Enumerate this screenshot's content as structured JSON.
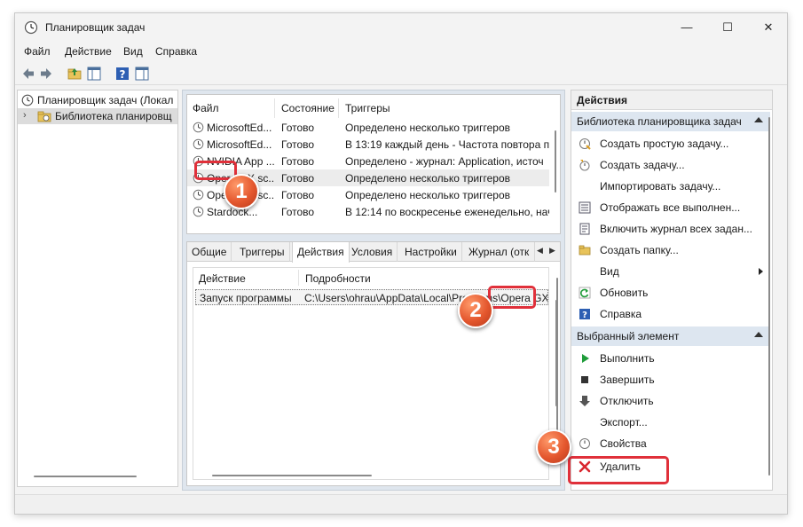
{
  "window": {
    "title": "Планировщик задач",
    "min_glyph": "—",
    "max_glyph": "☐",
    "close_glyph": "✕"
  },
  "menu": {
    "file": "Файл",
    "action": "Действие",
    "view": "Вид",
    "help": "Справка"
  },
  "tree": {
    "root": "Планировщик задач (Локал",
    "library": "Библиотека планировщ"
  },
  "tasks": {
    "columns": [
      "Файл",
      "Состояние",
      "Триггеры"
    ],
    "rows": [
      {
        "name": "MicrosoftEd...",
        "status": "Готово",
        "trigger": "Определено несколько триггеров"
      },
      {
        "name": "MicrosoftEd...",
        "status": "Готово",
        "trigger": "В 13:19 каждый день - Частота повтора по"
      },
      {
        "name": "NVIDIA App ...",
        "status": "Готово",
        "trigger": "Определено - журнал: Application, источ"
      },
      {
        "name": "Opera GX sc...",
        "status": "Готово",
        "trigger": "Определено несколько триггеров"
      },
      {
        "name": "Opera GX sc...",
        "status": "Готово",
        "trigger": "Определено несколько триггеров"
      },
      {
        "name": "Stardock...",
        "status": "Готово",
        "trigger": "В 12:14 по воскресенье еженедельно, нач"
      }
    ]
  },
  "details": {
    "tabs": [
      "Общие",
      "Триггеры",
      "Действия",
      "Условия",
      "Настройки",
      "Журнал (отк"
    ],
    "active_tab": "Действия",
    "columns": [
      "Действие",
      "Подробности"
    ],
    "row": {
      "action": "Запуск программы",
      "details": "C:\\Users\\ohrau\\AppData\\Local\\Programs\\Opera GX"
    }
  },
  "actions": {
    "header": "Действия",
    "library_section": "Библиотека планировщика задач",
    "library_items": [
      {
        "label": "Создать простую задачу...",
        "icon": "simple-task-icon"
      },
      {
        "label": "Создать задачу...",
        "icon": "create-task-icon"
      },
      {
        "label": "Импортировать задачу...",
        "icon": ""
      },
      {
        "label": "Отображать все выполнен...",
        "icon": "running-tasks-icon"
      },
      {
        "label": "Включить журнал всех задан...",
        "icon": "journal-icon"
      },
      {
        "label": "Создать папку...",
        "icon": "folder-icon"
      },
      {
        "label": "Вид",
        "icon": ""
      },
      {
        "label": "Обновить",
        "icon": "refresh-icon"
      },
      {
        "label": "Справка",
        "icon": "help-icon"
      }
    ],
    "selected_section": "Выбранный элемент",
    "selected_items": [
      {
        "label": "Выполнить",
        "icon": "run-icon"
      },
      {
        "label": "Завершить",
        "icon": "stop-icon"
      },
      {
        "label": "Отключить",
        "icon": "disable-icon"
      },
      {
        "label": "Экспорт...",
        "icon": ""
      },
      {
        "label": "Свойства",
        "icon": "properties-icon"
      },
      {
        "label": "Удалить",
        "icon": "delete-icon"
      }
    ]
  },
  "badges": [
    "1",
    "2",
    "3"
  ],
  "colors": {
    "callout": "#e0303a",
    "badge": "#e4572e",
    "section_bg": "#dde6f0",
    "run_green": "#1f9c3a",
    "delete_red": "#d9262e"
  }
}
